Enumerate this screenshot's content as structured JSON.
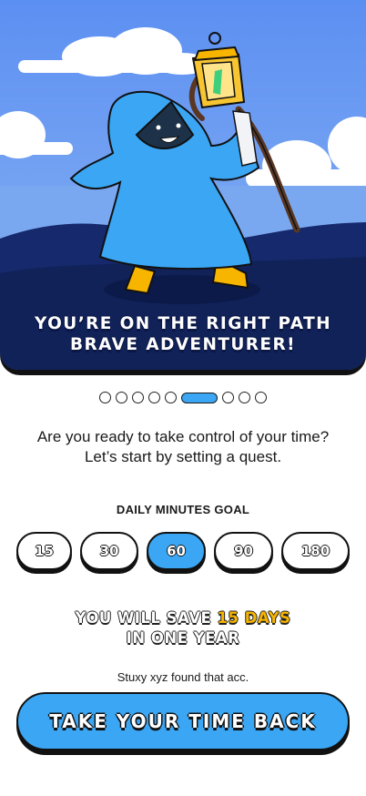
{
  "hero": {
    "title_line1": "YOU’RE ON THE RIGHT PATH",
    "title_line2": "BRAVE ADVENTURER!",
    "illustration": "hooded-adventurer-with-lantern"
  },
  "pagination": {
    "total": 9,
    "active_index": 5
  },
  "subtitle": {
    "line1": "Are you ready to take control of your time?",
    "line2": "Let’s start by setting a quest."
  },
  "goal": {
    "label": "DAILY MINUTES GOAL",
    "options": [
      "15",
      "30",
      "60",
      "90",
      "180"
    ],
    "selected": "60"
  },
  "savings": {
    "prefix": "YOU WILL SAVE",
    "highlight": "15 DAYS",
    "line2": "IN ONE YEAR"
  },
  "note": "Stuxy xyz found that acc.",
  "cta": {
    "label": "TAKE YOUR TIME BACK"
  },
  "colors": {
    "accent": "#3aa6f4",
    "highlight": "#f7b500",
    "sky": "#6b9ff5",
    "ground": "#162a6e"
  }
}
